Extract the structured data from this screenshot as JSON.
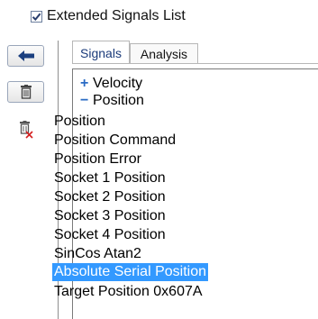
{
  "extended_signals": {
    "label": "Extended Signals List",
    "checked": true
  },
  "toolbar": {
    "back_icon": "arrow-left-icon",
    "delete_icon": "trash-icon",
    "delete_all_icon": "trash-x-icon"
  },
  "tabs": [
    {
      "label": "Signals",
      "active": true
    },
    {
      "label": "Analysis",
      "active": false
    }
  ],
  "tree": {
    "groups": [
      {
        "toggle": "+",
        "label": "Velocity",
        "expanded": false
      },
      {
        "toggle": "−",
        "label": "Position",
        "expanded": true
      }
    ],
    "position_items": [
      "Position",
      "Position Command",
      "Position Error",
      "Socket 1 Position",
      "Socket 2 Position",
      "Socket 3 Position",
      "Socket 4 Position",
      "SinCos Atan2",
      "Absolute Serial Position",
      "Target Position 0x607A"
    ],
    "selected_item": "Absolute Serial Position"
  },
  "colors": {
    "selection": "#3399ff",
    "toggle": "#2a6bc4",
    "tab_text": "#1a3a7a"
  }
}
